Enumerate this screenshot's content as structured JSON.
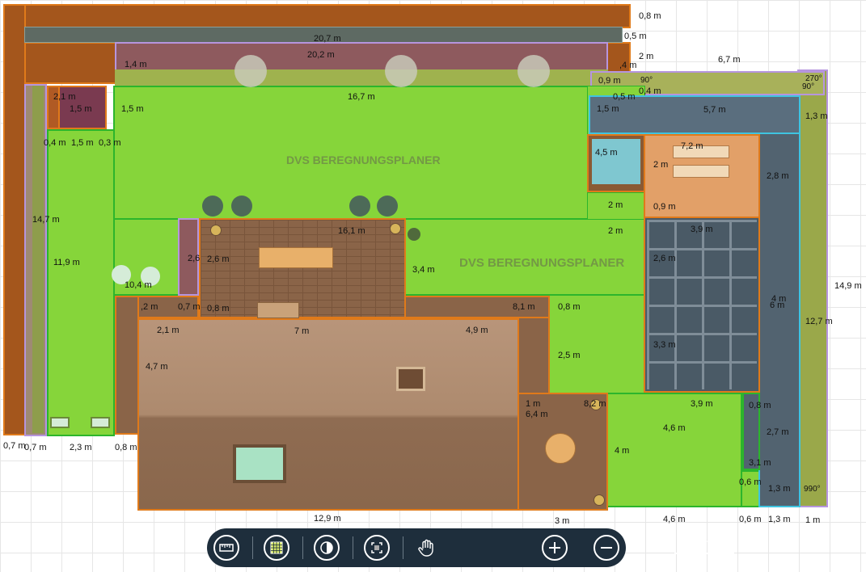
{
  "watermark": "DVS BEREGNUNGSPLANER",
  "dimensions": {
    "top_a": "0,8 m",
    "top_b": "20,7 m",
    "top_c": "0,5 m",
    "top_d": "20,2 m",
    "top_e": "2 m",
    "top_f": "6,7 m",
    "top_g": "1,4 m",
    "top_h": ",4 m",
    "top_i": "0,9 m",
    "top_j": "90°",
    "top_k": "0,5 m",
    "top_l": "0,4 m",
    "angle_270": "270°",
    "angle_90": "90°",
    "lawn_top": "16,7 m",
    "left_a": "2,1 m",
    "left_b": "1,5 m",
    "left_c": "1,5 m",
    "left_d": "0,4 m",
    "left_e": "1,5 m",
    "left_f": "0,3 m",
    "right_a": "1,5 m",
    "right_b": "5,7 m",
    "right_c": "1,3 m",
    "pool": "4,5 m",
    "deck_w": "7,2 m",
    "deck_h": "2 m",
    "deck_gap": "0,9 m",
    "right_d": "2,8 m",
    "mid_a": "2 m",
    "mid_b": "2 m",
    "left_len": "14,7 m",
    "left_lawn": "11,9 m",
    "terrace_w": "16,1 m",
    "terrace_a": "2,6",
    "terrace_b": "2,6 m",
    "lawn_mid": "3,4 m",
    "glass_w": "3,9 m",
    "glass_a": "2,6 m",
    "planter": "10,4 m",
    "row_a": ",2 m",
    "row_b": "0,7 m",
    "row_c": "0,8 m",
    "path_w": "8,1 m",
    "lawn_r": "0,8 m",
    "right_e": "4 m",
    "right_f": "6 m",
    "right_total": "14,9 m",
    "right_g": "12,7 m",
    "house_a": "2,1 m",
    "house_b": "7 m",
    "house_c": "4,9 m",
    "house_d": "4,7 m",
    "lawn_e": "2,5 m",
    "glass_b": "3,3 m",
    "patio_a": "1 m",
    "patio_b": "8,2 m",
    "patio_c": "6,4 m",
    "lawn_f": "3,9 m",
    "lawn_g": "0,8 m",
    "lawn_h": "4,6 m",
    "lawn_i": "2,7 m",
    "lawn_j": "4 m",
    "lawn_k": "3,1 m",
    "lawn_l": "0,6 m",
    "lawn_m": "1,3 m",
    "angle_990": "990°",
    "bot_a": "0,7 m",
    "bot_b": "0,7 m",
    "bot_c": "2,3 m",
    "bot_d": "0,8 m",
    "bot_e": "12,9 m",
    "bot_f": "3 m",
    "bot_g": "4,6 m",
    "bot_h": "0,6 m",
    "bot_i": "1,3 m",
    "bot_j": "1 m"
  },
  "toolbar": {
    "scale_label": "2 m",
    "buttons": [
      "ruler-icon",
      "grid-icon",
      "contrast-icon",
      "center-icon",
      "pan-hand-icon",
      "zoom-in-icon",
      "zoom-out-icon"
    ]
  },
  "colors": {
    "lawn": "#86d53a",
    "soil": "#a4561c",
    "paving": "#8a6448",
    "roof": "#b8957a",
    "water": "#7fc7d0",
    "wood": "#e2a068",
    "toolbar": "#1e2e3c"
  }
}
